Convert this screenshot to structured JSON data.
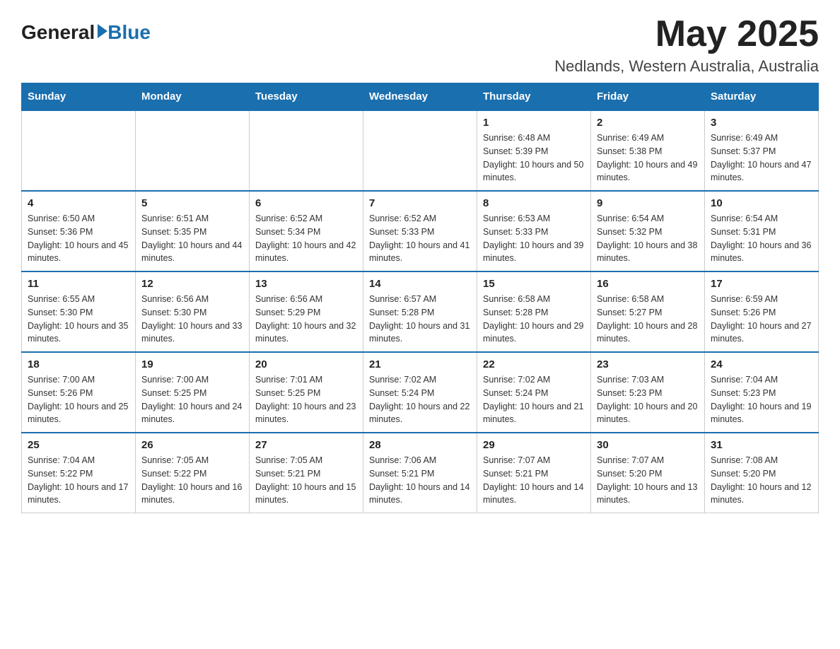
{
  "header": {
    "logo_general": "General",
    "logo_blue": "Blue",
    "month_title": "May 2025",
    "location": "Nedlands, Western Australia, Australia"
  },
  "days_of_week": [
    "Sunday",
    "Monday",
    "Tuesday",
    "Wednesday",
    "Thursday",
    "Friday",
    "Saturday"
  ],
  "weeks": [
    [
      {
        "day": "",
        "sunrise": "",
        "sunset": "",
        "daylight": ""
      },
      {
        "day": "",
        "sunrise": "",
        "sunset": "",
        "daylight": ""
      },
      {
        "day": "",
        "sunrise": "",
        "sunset": "",
        "daylight": ""
      },
      {
        "day": "",
        "sunrise": "",
        "sunset": "",
        "daylight": ""
      },
      {
        "day": "1",
        "sunrise": "Sunrise: 6:48 AM",
        "sunset": "Sunset: 5:39 PM",
        "daylight": "Daylight: 10 hours and 50 minutes."
      },
      {
        "day": "2",
        "sunrise": "Sunrise: 6:49 AM",
        "sunset": "Sunset: 5:38 PM",
        "daylight": "Daylight: 10 hours and 49 minutes."
      },
      {
        "day": "3",
        "sunrise": "Sunrise: 6:49 AM",
        "sunset": "Sunset: 5:37 PM",
        "daylight": "Daylight: 10 hours and 47 minutes."
      }
    ],
    [
      {
        "day": "4",
        "sunrise": "Sunrise: 6:50 AM",
        "sunset": "Sunset: 5:36 PM",
        "daylight": "Daylight: 10 hours and 45 minutes."
      },
      {
        "day": "5",
        "sunrise": "Sunrise: 6:51 AM",
        "sunset": "Sunset: 5:35 PM",
        "daylight": "Daylight: 10 hours and 44 minutes."
      },
      {
        "day": "6",
        "sunrise": "Sunrise: 6:52 AM",
        "sunset": "Sunset: 5:34 PM",
        "daylight": "Daylight: 10 hours and 42 minutes."
      },
      {
        "day": "7",
        "sunrise": "Sunrise: 6:52 AM",
        "sunset": "Sunset: 5:33 PM",
        "daylight": "Daylight: 10 hours and 41 minutes."
      },
      {
        "day": "8",
        "sunrise": "Sunrise: 6:53 AM",
        "sunset": "Sunset: 5:33 PM",
        "daylight": "Daylight: 10 hours and 39 minutes."
      },
      {
        "day": "9",
        "sunrise": "Sunrise: 6:54 AM",
        "sunset": "Sunset: 5:32 PM",
        "daylight": "Daylight: 10 hours and 38 minutes."
      },
      {
        "day": "10",
        "sunrise": "Sunrise: 6:54 AM",
        "sunset": "Sunset: 5:31 PM",
        "daylight": "Daylight: 10 hours and 36 minutes."
      }
    ],
    [
      {
        "day": "11",
        "sunrise": "Sunrise: 6:55 AM",
        "sunset": "Sunset: 5:30 PM",
        "daylight": "Daylight: 10 hours and 35 minutes."
      },
      {
        "day": "12",
        "sunrise": "Sunrise: 6:56 AM",
        "sunset": "Sunset: 5:30 PM",
        "daylight": "Daylight: 10 hours and 33 minutes."
      },
      {
        "day": "13",
        "sunrise": "Sunrise: 6:56 AM",
        "sunset": "Sunset: 5:29 PM",
        "daylight": "Daylight: 10 hours and 32 minutes."
      },
      {
        "day": "14",
        "sunrise": "Sunrise: 6:57 AM",
        "sunset": "Sunset: 5:28 PM",
        "daylight": "Daylight: 10 hours and 31 minutes."
      },
      {
        "day": "15",
        "sunrise": "Sunrise: 6:58 AM",
        "sunset": "Sunset: 5:28 PM",
        "daylight": "Daylight: 10 hours and 29 minutes."
      },
      {
        "day": "16",
        "sunrise": "Sunrise: 6:58 AM",
        "sunset": "Sunset: 5:27 PM",
        "daylight": "Daylight: 10 hours and 28 minutes."
      },
      {
        "day": "17",
        "sunrise": "Sunrise: 6:59 AM",
        "sunset": "Sunset: 5:26 PM",
        "daylight": "Daylight: 10 hours and 27 minutes."
      }
    ],
    [
      {
        "day": "18",
        "sunrise": "Sunrise: 7:00 AM",
        "sunset": "Sunset: 5:26 PM",
        "daylight": "Daylight: 10 hours and 25 minutes."
      },
      {
        "day": "19",
        "sunrise": "Sunrise: 7:00 AM",
        "sunset": "Sunset: 5:25 PM",
        "daylight": "Daylight: 10 hours and 24 minutes."
      },
      {
        "day": "20",
        "sunrise": "Sunrise: 7:01 AM",
        "sunset": "Sunset: 5:25 PM",
        "daylight": "Daylight: 10 hours and 23 minutes."
      },
      {
        "day": "21",
        "sunrise": "Sunrise: 7:02 AM",
        "sunset": "Sunset: 5:24 PM",
        "daylight": "Daylight: 10 hours and 22 minutes."
      },
      {
        "day": "22",
        "sunrise": "Sunrise: 7:02 AM",
        "sunset": "Sunset: 5:24 PM",
        "daylight": "Daylight: 10 hours and 21 minutes."
      },
      {
        "day": "23",
        "sunrise": "Sunrise: 7:03 AM",
        "sunset": "Sunset: 5:23 PM",
        "daylight": "Daylight: 10 hours and 20 minutes."
      },
      {
        "day": "24",
        "sunrise": "Sunrise: 7:04 AM",
        "sunset": "Sunset: 5:23 PM",
        "daylight": "Daylight: 10 hours and 19 minutes."
      }
    ],
    [
      {
        "day": "25",
        "sunrise": "Sunrise: 7:04 AM",
        "sunset": "Sunset: 5:22 PM",
        "daylight": "Daylight: 10 hours and 17 minutes."
      },
      {
        "day": "26",
        "sunrise": "Sunrise: 7:05 AM",
        "sunset": "Sunset: 5:22 PM",
        "daylight": "Daylight: 10 hours and 16 minutes."
      },
      {
        "day": "27",
        "sunrise": "Sunrise: 7:05 AM",
        "sunset": "Sunset: 5:21 PM",
        "daylight": "Daylight: 10 hours and 15 minutes."
      },
      {
        "day": "28",
        "sunrise": "Sunrise: 7:06 AM",
        "sunset": "Sunset: 5:21 PM",
        "daylight": "Daylight: 10 hours and 14 minutes."
      },
      {
        "day": "29",
        "sunrise": "Sunrise: 7:07 AM",
        "sunset": "Sunset: 5:21 PM",
        "daylight": "Daylight: 10 hours and 14 minutes."
      },
      {
        "day": "30",
        "sunrise": "Sunrise: 7:07 AM",
        "sunset": "Sunset: 5:20 PM",
        "daylight": "Daylight: 10 hours and 13 minutes."
      },
      {
        "day": "31",
        "sunrise": "Sunrise: 7:08 AM",
        "sunset": "Sunset: 5:20 PM",
        "daylight": "Daylight: 10 hours and 12 minutes."
      }
    ]
  ]
}
